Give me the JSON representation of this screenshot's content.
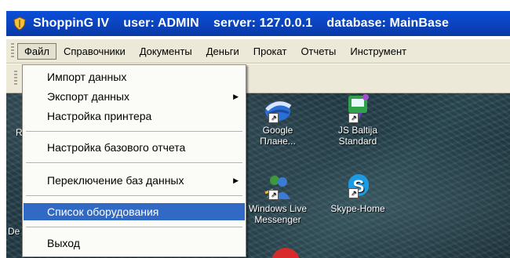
{
  "titlebar": {
    "title": "ShoppinG IV    user: ADMIN    server: 127.0.0.1    database: MainBase",
    "icon": "shield-icon"
  },
  "menubar": {
    "items": [
      "Файл",
      "Справочники",
      "Документы",
      "Деньги",
      "Прокат",
      "Отчеты",
      "Инструмент"
    ]
  },
  "file_menu": {
    "items": [
      {
        "label": "Импорт данных"
      },
      {
        "label": "Экспорт данных",
        "submenu": true
      },
      {
        "label": "Настройка принтера"
      },
      {
        "label": "Настройка базового отчета"
      },
      {
        "label": "Переключение баз данных",
        "submenu": true
      },
      {
        "label": "Список оборудования",
        "selected": true
      },
      {
        "label": "Выход"
      }
    ]
  },
  "desktop": {
    "edge_letters": [
      "R",
      "De"
    ],
    "icons": [
      {
        "label_line1": "Google",
        "label_line2": "Плане...",
        "icon": "google-earth-icon"
      },
      {
        "label_line1": "JS Baltija",
        "label_line2": "Standard",
        "icon": "js-baltija-icon"
      },
      {
        "label_line1": "Windows Live",
        "label_line2": "Messenger",
        "icon": "windows-live-messenger-icon"
      },
      {
        "label_line1": "Skype-Home",
        "label_line2": "",
        "icon": "skype-icon"
      }
    ]
  },
  "colors": {
    "titlebar": "#0b46c4",
    "menu_highlight": "#316ac5",
    "menu_background": "#fbfbf8",
    "menubar_background": "#ece9d8"
  }
}
